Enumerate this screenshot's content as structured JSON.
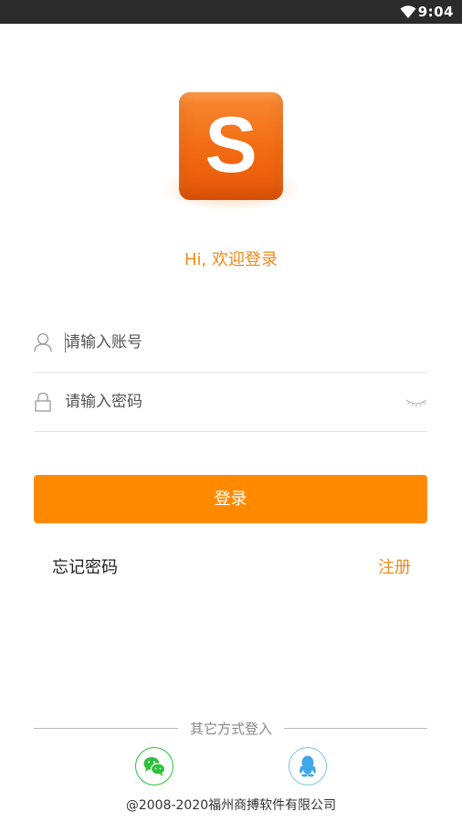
{
  "status_bar": {
    "time": "9:04",
    "icons": [
      "wifi-icon"
    ]
  },
  "logo": {
    "letter": "S",
    "color": "#f26a12"
  },
  "welcome": "Hi, 欢迎登录",
  "account": {
    "placeholder": "请输入账号",
    "value": "",
    "icon": "user-icon"
  },
  "password": {
    "placeholder": "请输入密码",
    "value": "",
    "icon": "lock-icon",
    "toggle_icon": "eye-closed-icon"
  },
  "login_button": "登录",
  "links": {
    "forgot": "忘记密码",
    "register": "注册"
  },
  "other_login": {
    "label": "其它方式登入",
    "providers": [
      {
        "name": "wechat",
        "icon": "wechat-icon",
        "color": "#2bc23a"
      },
      {
        "name": "qq",
        "icon": "qq-icon",
        "color": "#3fa8e8"
      }
    ]
  },
  "footer": {
    "copyright": "@2008-2020福州商搏软件有限公司"
  },
  "colors": {
    "accent": "#ff8a00",
    "accent_text": "#f08a1a",
    "status_bar": "#2b2b2b"
  }
}
